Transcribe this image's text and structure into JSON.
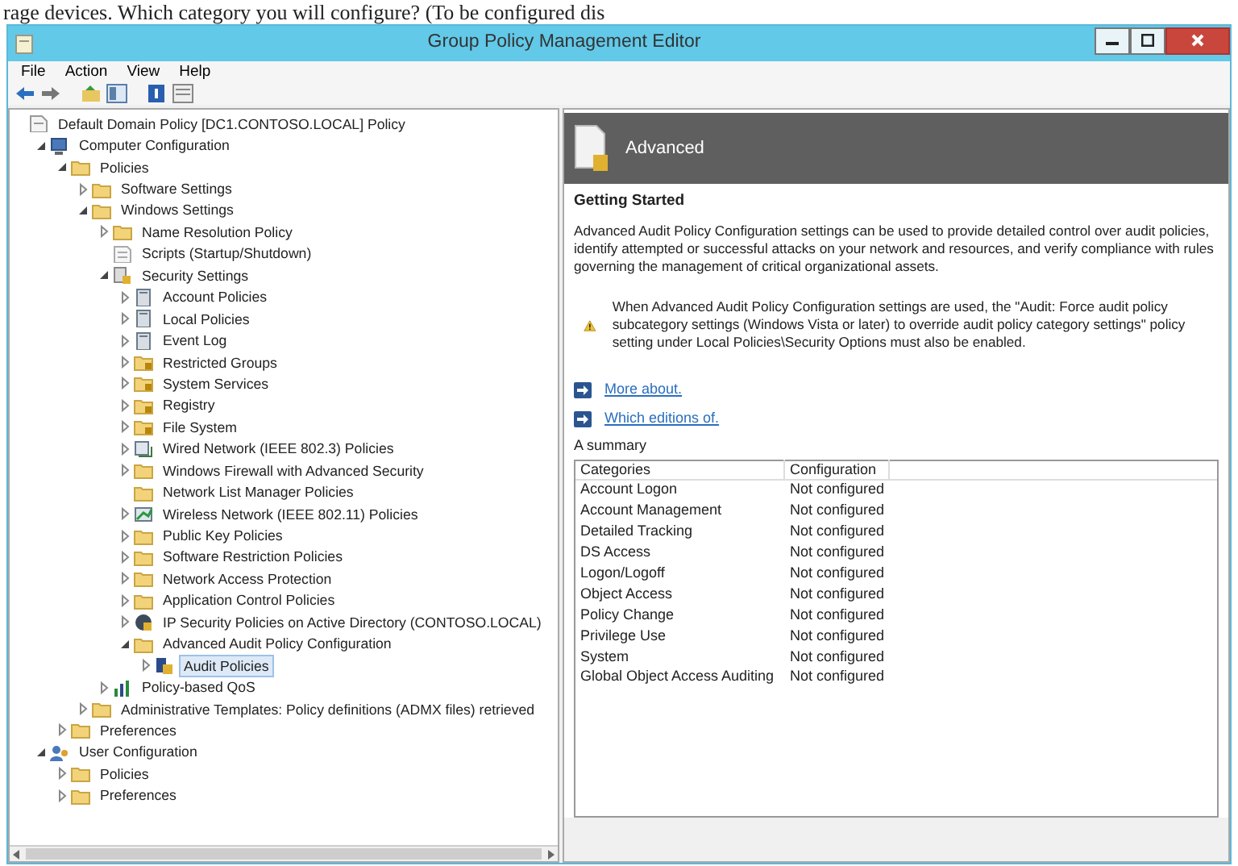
{
  "caption": "rage devices. Which category you will configure? (To be configured dis",
  "window": {
    "title": "Group Policy Management Editor"
  },
  "menu": [
    "File",
    "Action",
    "View",
    "Help"
  ],
  "toolbar": [
    {
      "kind": "back"
    },
    {
      "kind": "forward"
    },
    {
      "kind": "up"
    },
    {
      "kind": "tree"
    },
    {
      "kind": "help"
    },
    {
      "kind": "panel"
    }
  ],
  "tree": [
    {
      "label": "Default Domain Policy [DC1.CONTOSO.LOCAL] Policy",
      "kind": "policy",
      "selected": false,
      "children": [
        {
          "label": "Computer Configuration",
          "kind": "computer",
          "expanded": true,
          "selected": false,
          "children": [
            {
              "label": "Policies",
              "kind": "folder",
              "expanded": true,
              "selected": false,
              "children": [
                {
                  "label": "Software Settings",
                  "kind": "folder",
                  "expanded": false,
                  "selected": false
                },
                {
                  "label": "Windows Settings",
                  "kind": "folder",
                  "expanded": true,
                  "selected": false,
                  "children": [
                    {
                      "label": "Name Resolution Policy",
                      "kind": "folder",
                      "expanded": false,
                      "selected": false
                    },
                    {
                      "label": "Scripts (Startup/Shutdown)",
                      "kind": "script",
                      "selected": false
                    },
                    {
                      "label": "Security Settings",
                      "kind": "secure",
                      "expanded": true,
                      "selected": false,
                      "children": [
                        {
                          "label": "Account Policies",
                          "kind": "book",
                          "expanded": false,
                          "selected": false
                        },
                        {
                          "label": "Local Policies",
                          "kind": "book",
                          "expanded": false,
                          "selected": false
                        },
                        {
                          "label": "Event Log",
                          "kind": "book",
                          "expanded": false,
                          "selected": false
                        },
                        {
                          "label": "Restricted Groups",
                          "kind": "securefolder",
                          "expanded": false,
                          "selected": false
                        },
                        {
                          "label": "System Services",
                          "kind": "securefolder",
                          "expanded": false,
                          "selected": false
                        },
                        {
                          "label": "Registry",
                          "kind": "securefolder",
                          "expanded": false,
                          "selected": false
                        },
                        {
                          "label": "File System",
                          "kind": "securefolder",
                          "expanded": false,
                          "selected": false
                        },
                        {
                          "label": "Wired Network (IEEE 802.3) Policies",
                          "kind": "network",
                          "expanded": false,
                          "selected": false
                        },
                        {
                          "label": "Windows Firewall with Advanced Security",
                          "kind": "folder",
                          "expanded": false,
                          "selected": false
                        },
                        {
                          "label": "Network List Manager Policies",
                          "kind": "folder",
                          "selected": false
                        },
                        {
                          "label": "Wireless Network (IEEE 802.11) Policies",
                          "kind": "wireless",
                          "expanded": false,
                          "selected": false
                        },
                        {
                          "label": "Public Key Policies",
                          "kind": "folder",
                          "expanded": false,
                          "selected": false
                        },
                        {
                          "label": "Software Restriction Policies",
                          "kind": "folder",
                          "expanded": false,
                          "selected": false
                        },
                        {
                          "label": "Network Access Protection",
                          "kind": "folder",
                          "expanded": false,
                          "selected": false
                        },
                        {
                          "label": "Application Control Policies",
                          "kind": "folder",
                          "expanded": false,
                          "selected": false
                        },
                        {
                          "label": "IP Security Policies on Active Directory (CONTOSO.LOCAL)",
                          "kind": "ipsec",
                          "expanded": false,
                          "selected": false
                        },
                        {
                          "label": "Advanced Audit Policy Configuration",
                          "kind": "folder",
                          "expanded": true,
                          "selected": false,
                          "children": [
                            {
                              "label": "Audit Policies",
                              "kind": "audit",
                              "expanded": false,
                              "selected": true
                            }
                          ]
                        }
                      ]
                    },
                    {
                      "label": "Policy-based QoS",
                      "kind": "chart",
                      "expanded": false,
                      "selected": false
                    }
                  ]
                },
                {
                  "label": "Administrative Templates: Policy definitions (ADMX files) retrieved",
                  "kind": "folder",
                  "expanded": false,
                  "selected": false
                }
              ]
            },
            {
              "label": "Preferences",
              "kind": "folder",
              "expanded": false,
              "selected": false
            }
          ]
        },
        {
          "label": "User Configuration",
          "kind": "user",
          "expanded": true,
          "selected": false,
          "children": [
            {
              "label": "Policies",
              "kind": "folder",
              "expanded": false,
              "selected": false
            },
            {
              "label": "Preferences",
              "kind": "folder",
              "expanded": false,
              "selected": false
            }
          ]
        }
      ]
    }
  ],
  "details": {
    "header": "Advanced",
    "heading": "Getting Started",
    "intro": "Advanced Audit Policy Configuration settings can be used to provide detailed control over audit policies, identify attempted or successful attacks on your network and resources, and verify compliance with rules governing the management of critical organizational assets.",
    "warning": "When Advanced Audit Policy Configuration settings are used, the \"Audit: Force audit policy subcategory settings (Windows Vista or later) to override audit policy category settings\" policy setting under Local Policies\\Security Options must also be enabled.",
    "links": [
      "More about.",
      "Which editions of."
    ],
    "summary_label": "A summary",
    "table": {
      "columns": [
        "Categories",
        "Configuration"
      ],
      "rows": [
        [
          "Account Logon",
          "Not configured"
        ],
        [
          "Account Management",
          "Not configured"
        ],
        [
          "Detailed Tracking",
          "Not configured"
        ],
        [
          "DS Access",
          "Not configured"
        ],
        [
          "Logon/Logoff",
          "Not configured"
        ],
        [
          "Object Access",
          "Not configured"
        ],
        [
          "Policy Change",
          "Not configured"
        ],
        [
          "Privilege Use",
          "Not configured"
        ],
        [
          "System",
          "Not configured"
        ],
        [
          "Global Object Access Auditing",
          "Not configured"
        ]
      ]
    }
  }
}
